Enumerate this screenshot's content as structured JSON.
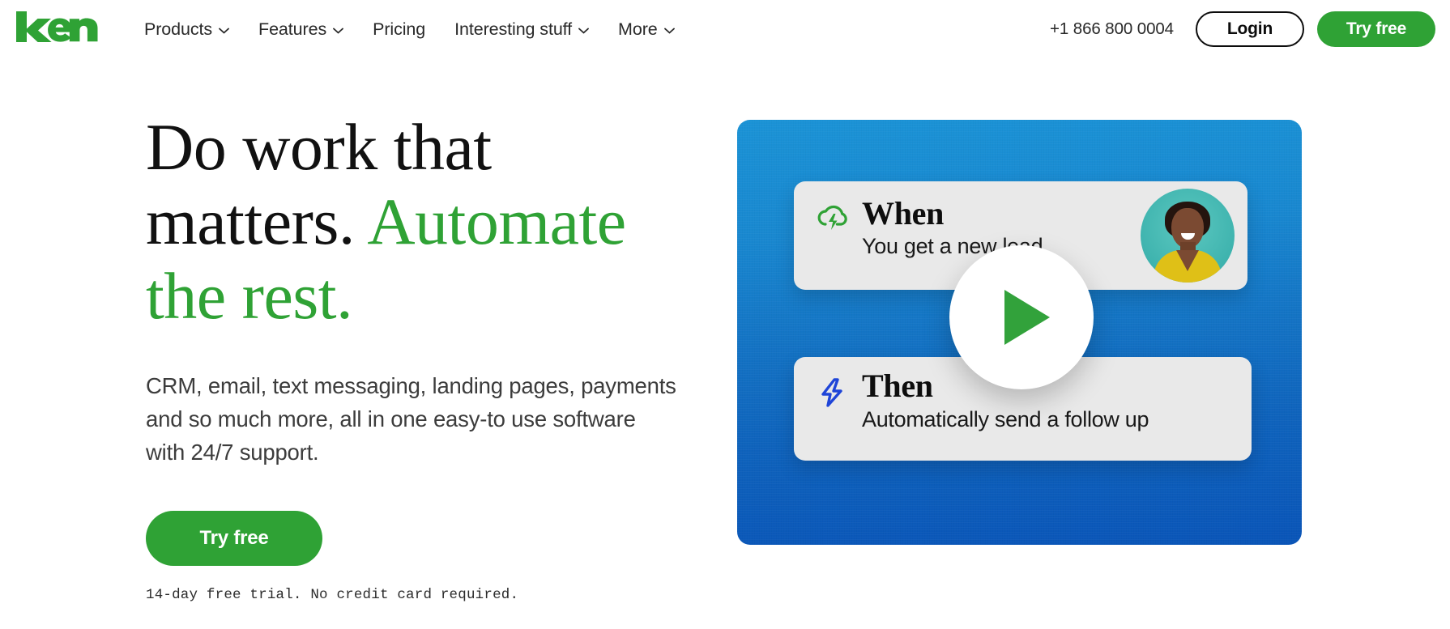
{
  "brand": {
    "logo_text": "keap",
    "green": "#2fa235",
    "dark": "#0c0c0c",
    "blue_top": "#1b93d6",
    "blue_bottom": "#0a55b8"
  },
  "header": {
    "nav": [
      {
        "label": "Products",
        "has_caret": true
      },
      {
        "label": "Features",
        "has_caret": true
      },
      {
        "label": "Pricing",
        "has_caret": false
      },
      {
        "label": "Interesting stuff",
        "has_caret": true
      },
      {
        "label": "More",
        "has_caret": true
      }
    ],
    "phone": "+1 866 800 0004",
    "login_label": "Login",
    "try_free_label": "Try free"
  },
  "hero": {
    "headline_line1": "Do work that",
    "headline_line2a": "matters. ",
    "headline_line2b": "Automate",
    "headline_line3": "the rest.",
    "subcopy": "CRM, email, text messaging, landing pages, payments and so much more, all in one easy-to use software with 24/7 support.",
    "cta_label": "Try free",
    "trial_note": "14-day free trial. No credit card required."
  },
  "video": {
    "play_icon": "play-icon",
    "cards": [
      {
        "icon": "cloud-lightning-icon",
        "icon_color": "#2fa235",
        "accent_color": "#63c93e",
        "title": "When",
        "subtitle": "You get a new lead",
        "has_avatar": true
      },
      {
        "icon": "lightning-bolt-icon",
        "icon_color": "#1f45d8",
        "accent_color": "#45c3bf",
        "title": "Then",
        "subtitle": "Automatically send a follow up",
        "has_avatar": false
      }
    ]
  }
}
